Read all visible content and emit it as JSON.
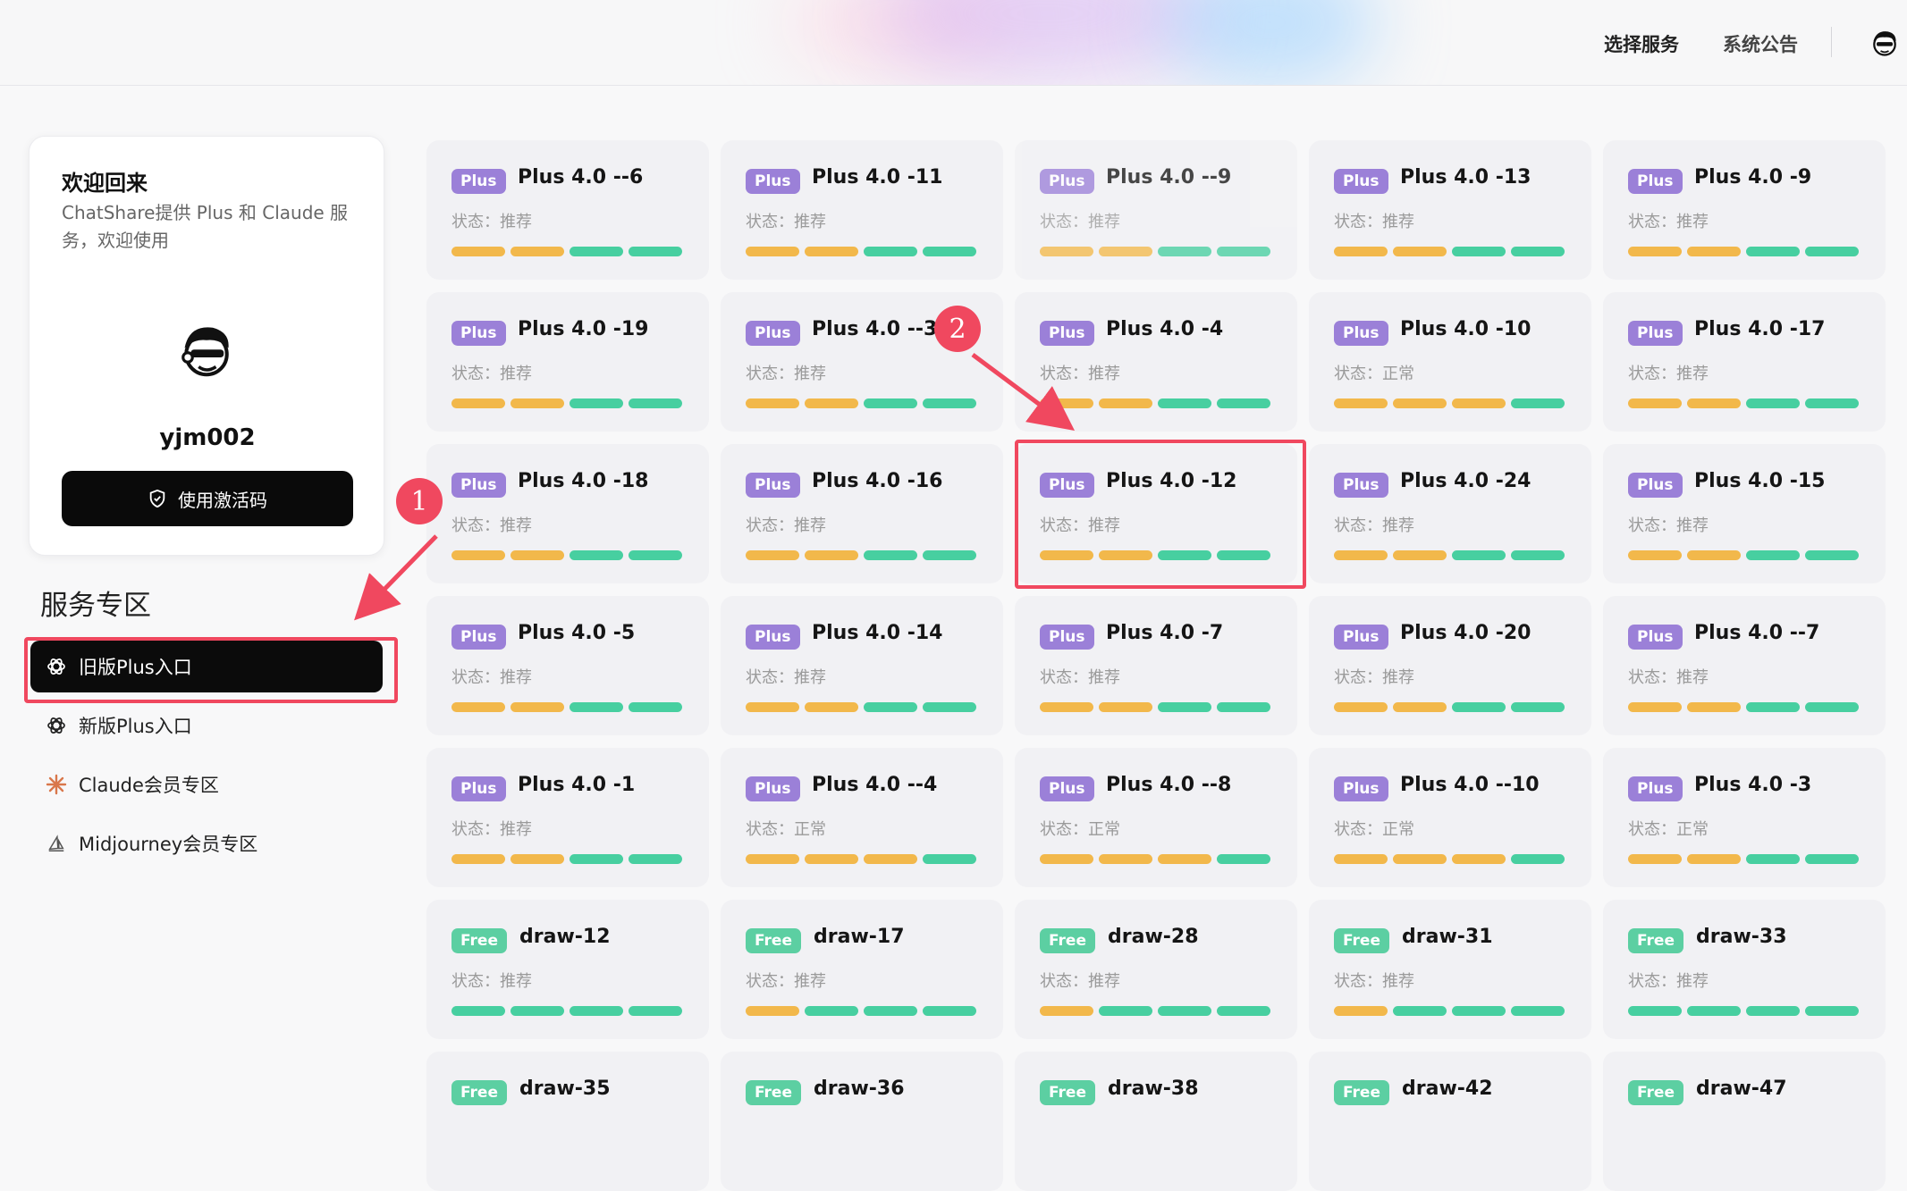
{
  "nav": {
    "select_service": "选择服务",
    "announcement": "系统公告"
  },
  "welcome": {
    "title": "欢迎回来",
    "subtitle": "ChatShare提供 Plus 和 Claude 服务，欢迎使用",
    "username": "yjm002",
    "activate_label": "使用激活码"
  },
  "sidebar": {
    "section_title": "服务专区",
    "items": [
      {
        "label": "旧版Plus入口",
        "icon": "openai-icon",
        "active": true
      },
      {
        "label": "新版Plus入口",
        "icon": "openai-icon",
        "active": false
      },
      {
        "label": "Claude会员专区",
        "icon": "claude-icon",
        "active": false
      },
      {
        "label": "Midjourney会员专区",
        "icon": "midjourney-icon",
        "active": false
      }
    ]
  },
  "annotations": {
    "marker_1": "1",
    "marker_2": "2"
  },
  "colors": {
    "orange": "#f2b84b",
    "green": "#47cfa0",
    "highlight": "#f0485f",
    "plus_badge": "#9b80d8",
    "free_badge": "#5ccfa2"
  },
  "services": [
    {
      "badge": "Plus",
      "name": "Plus 4.0 --6",
      "status": "状态：推荐",
      "bars": [
        "o",
        "o",
        "g",
        "g"
      ]
    },
    {
      "badge": "Plus",
      "name": "Plus 4.0 -11",
      "status": "状态：推荐",
      "bars": [
        "o",
        "o",
        "g",
        "g"
      ]
    },
    {
      "badge": "Plus",
      "name": "Plus 4.0 --9",
      "status": "状态：推荐",
      "bars": [
        "o",
        "o",
        "g",
        "g"
      ]
    },
    {
      "badge": "Plus",
      "name": "Plus 4.0 -13",
      "status": "状态：推荐",
      "bars": [
        "o",
        "o",
        "g",
        "g"
      ]
    },
    {
      "badge": "Plus",
      "name": "Plus 4.0 -9",
      "status": "状态：推荐",
      "bars": [
        "o",
        "o",
        "g",
        "g"
      ]
    },
    {
      "badge": "Plus",
      "name": "Plus 4.0 -19",
      "status": "状态：推荐",
      "bars": [
        "o",
        "o",
        "g",
        "g"
      ]
    },
    {
      "badge": "Plus",
      "name": "Plus 4.0 --3",
      "status": "状态：推荐",
      "bars": [
        "o",
        "o",
        "g",
        "g"
      ]
    },
    {
      "badge": "Plus",
      "name": "Plus 4.0 -4",
      "status": "状态：推荐",
      "bars": [
        "o",
        "o",
        "g",
        "g"
      ]
    },
    {
      "badge": "Plus",
      "name": "Plus 4.0 -10",
      "status": "状态：正常",
      "bars": [
        "o",
        "o",
        "o",
        "g"
      ]
    },
    {
      "badge": "Plus",
      "name": "Plus 4.0 -17",
      "status": "状态：推荐",
      "bars": [
        "o",
        "o",
        "g",
        "g"
      ]
    },
    {
      "badge": "Plus",
      "name": "Plus 4.0 -18",
      "status": "状态：推荐",
      "bars": [
        "o",
        "o",
        "g",
        "g"
      ]
    },
    {
      "badge": "Plus",
      "name": "Plus 4.0 -16",
      "status": "状态：推荐",
      "bars": [
        "o",
        "o",
        "g",
        "g"
      ]
    },
    {
      "badge": "Plus",
      "name": "Plus 4.0 -12",
      "status": "状态：推荐",
      "bars": [
        "o",
        "o",
        "g",
        "g"
      ]
    },
    {
      "badge": "Plus",
      "name": "Plus 4.0 -24",
      "status": "状态：推荐",
      "bars": [
        "o",
        "o",
        "g",
        "g"
      ]
    },
    {
      "badge": "Plus",
      "name": "Plus 4.0 -15",
      "status": "状态：推荐",
      "bars": [
        "o",
        "o",
        "g",
        "g"
      ]
    },
    {
      "badge": "Plus",
      "name": "Plus 4.0 -5",
      "status": "状态：推荐",
      "bars": [
        "o",
        "o",
        "g",
        "g"
      ]
    },
    {
      "badge": "Plus",
      "name": "Plus 4.0 -14",
      "status": "状态：推荐",
      "bars": [
        "o",
        "o",
        "g",
        "g"
      ]
    },
    {
      "badge": "Plus",
      "name": "Plus 4.0 -7",
      "status": "状态：推荐",
      "bars": [
        "o",
        "o",
        "g",
        "g"
      ]
    },
    {
      "badge": "Plus",
      "name": "Plus 4.0 -20",
      "status": "状态：推荐",
      "bars": [
        "o",
        "o",
        "g",
        "g"
      ]
    },
    {
      "badge": "Plus",
      "name": "Plus 4.0 --7",
      "status": "状态：推荐",
      "bars": [
        "o",
        "o",
        "g",
        "g"
      ]
    },
    {
      "badge": "Plus",
      "name": "Plus 4.0 -1",
      "status": "状态：推荐",
      "bars": [
        "o",
        "o",
        "g",
        "g"
      ]
    },
    {
      "badge": "Plus",
      "name": "Plus 4.0 --4",
      "status": "状态：正常",
      "bars": [
        "o",
        "o",
        "o",
        "g"
      ]
    },
    {
      "badge": "Plus",
      "name": "Plus 4.0 --8",
      "status": "状态：正常",
      "bars": [
        "o",
        "o",
        "o",
        "g"
      ]
    },
    {
      "badge": "Plus",
      "name": "Plus 4.0 --10",
      "status": "状态：正常",
      "bars": [
        "o",
        "o",
        "o",
        "g"
      ]
    },
    {
      "badge": "Plus",
      "name": "Plus 4.0 -3",
      "status": "状态：正常",
      "bars": [
        "o",
        "o",
        "g",
        "g"
      ]
    },
    {
      "badge": "Free",
      "name": "draw-12",
      "status": "状态：推荐",
      "bars": [
        "g",
        "g",
        "g",
        "g"
      ]
    },
    {
      "badge": "Free",
      "name": "draw-17",
      "status": "状态：推荐",
      "bars": [
        "o",
        "g",
        "g",
        "g"
      ]
    },
    {
      "badge": "Free",
      "name": "draw-28",
      "status": "状态：推荐",
      "bars": [
        "o",
        "g",
        "g",
        "g"
      ]
    },
    {
      "badge": "Free",
      "name": "draw-31",
      "status": "状态：推荐",
      "bars": [
        "o",
        "g",
        "g",
        "g"
      ]
    },
    {
      "badge": "Free",
      "name": "draw-33",
      "status": "状态：推荐",
      "bars": [
        "g",
        "g",
        "g",
        "g"
      ]
    },
    {
      "badge": "Free",
      "name": "draw-35",
      "status": "",
      "bars": []
    },
    {
      "badge": "Free",
      "name": "draw-36",
      "status": "",
      "bars": []
    },
    {
      "badge": "Free",
      "name": "draw-38",
      "status": "",
      "bars": []
    },
    {
      "badge": "Free",
      "name": "draw-42",
      "status": "",
      "bars": []
    },
    {
      "badge": "Free",
      "name": "draw-47",
      "status": "",
      "bars": []
    }
  ]
}
